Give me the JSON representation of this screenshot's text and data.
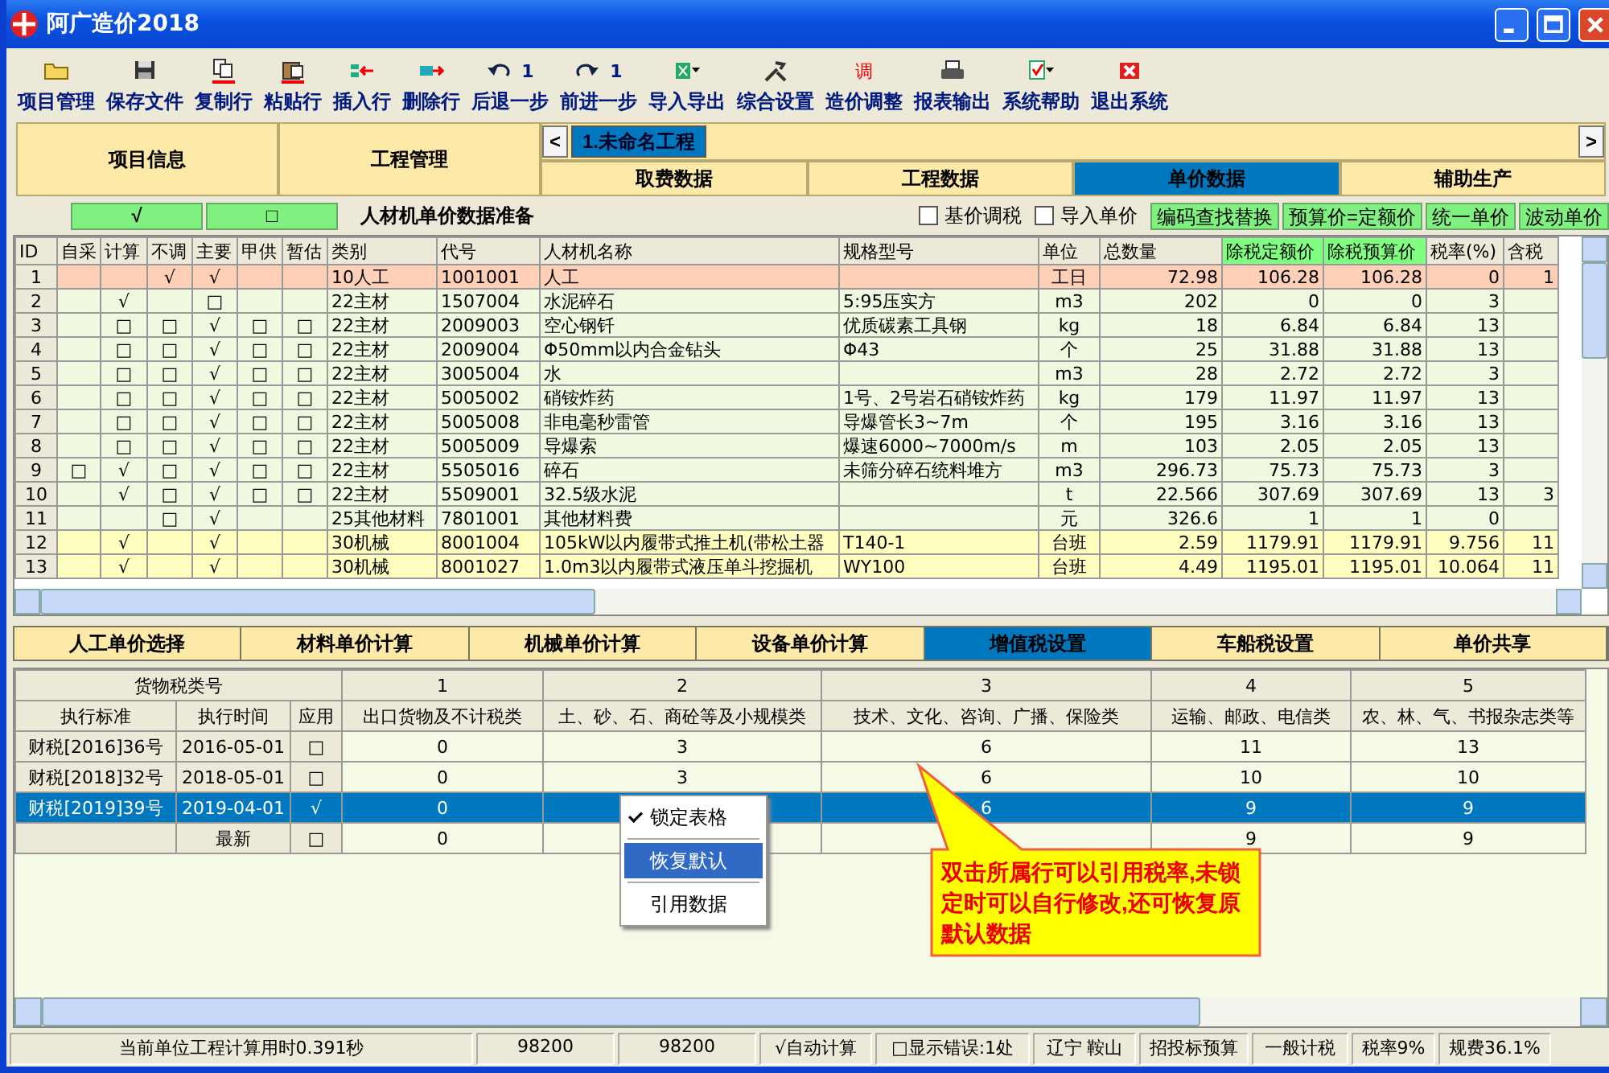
{
  "window": {
    "title": "阿广造价2018"
  },
  "toolbar": [
    {
      "label": "项目管理"
    },
    {
      "label": "保存文件"
    },
    {
      "label": "复制行"
    },
    {
      "label": "粘贴行"
    },
    {
      "label": "插入行"
    },
    {
      "label": "删除行"
    },
    {
      "label": "后退一步",
      "count": "1"
    },
    {
      "label": "前进一步",
      "count": "1"
    },
    {
      "label": "导入导出"
    },
    {
      "label": "综合设置"
    },
    {
      "label": "造价调整",
      "glyph": "调"
    },
    {
      "label": "报表输出"
    },
    {
      "label": "系统帮助"
    },
    {
      "label": "退出系统"
    }
  ],
  "nav": {
    "main_tabs": [
      "项目信息",
      "工程管理"
    ],
    "prev_arrow": "<",
    "next_arrow": ">",
    "project_tabs": [
      {
        "label": "1.未命名工程",
        "selected": true
      }
    ],
    "sub_tabs": [
      {
        "label": "取费数据",
        "selected": false
      },
      {
        "label": "工程数据",
        "selected": false
      },
      {
        "label": "单价数据",
        "selected": true
      },
      {
        "label": "辅助生产",
        "selected": false
      }
    ]
  },
  "actions": {
    "buttons": [
      "√",
      "□"
    ],
    "title": "人材机单价数据准备",
    "checkboxes": [
      {
        "label": "基价调税",
        "checked": false
      },
      {
        "label": "导入单价",
        "checked": false
      }
    ],
    "tool_buttons": [
      "编码查找替换",
      "预算价=定额价",
      "统一单价",
      "波动单价"
    ]
  },
  "grid": {
    "columns": [
      {
        "label": "ID",
        "highlight": false
      },
      {
        "label": "自采",
        "highlight": false
      },
      {
        "label": "计算",
        "highlight": false
      },
      {
        "label": "不调",
        "highlight": false
      },
      {
        "label": "主要",
        "highlight": false
      },
      {
        "label": "甲供",
        "highlight": false
      },
      {
        "label": "暂估",
        "highlight": false
      },
      {
        "label": "类别",
        "highlight": false
      },
      {
        "label": "代号",
        "highlight": false
      },
      {
        "label": "人材机名称",
        "highlight": false
      },
      {
        "label": "规格型号",
        "highlight": false
      },
      {
        "label": "单位",
        "highlight": false
      },
      {
        "label": "总数量",
        "highlight": false
      },
      {
        "label": "除税定额价",
        "highlight": true
      },
      {
        "label": "除税预算价",
        "highlight": true
      },
      {
        "label": "税率(%)",
        "highlight": false
      },
      {
        "label": "含税",
        "highlight": false
      }
    ],
    "rows": [
      {
        "kind": "labor",
        "cells": [
          "1",
          null,
          null,
          "√",
          "√",
          null,
          null,
          "10人工",
          "1001001",
          "人工",
          null,
          "工日",
          "72.98",
          "106.28",
          "106.28",
          "0",
          "1"
        ]
      },
      {
        "kind": "material",
        "cells": [
          "2",
          null,
          "√",
          null,
          "□",
          null,
          null,
          "22主材",
          "1507004",
          "水泥碎石",
          "5:95压实方",
          "m3",
          "202",
          "0",
          "0",
          "3",
          null
        ]
      },
      {
        "kind": "material",
        "cells": [
          "3",
          null,
          "□",
          "□",
          "√",
          "□",
          "□",
          "22主材",
          "2009003",
          "空心钢钎",
          "优质碳素工具钢",
          "kg",
          "18",
          "6.84",
          "6.84",
          "13",
          null
        ]
      },
      {
        "kind": "material",
        "cells": [
          "4",
          null,
          "□",
          "□",
          "√",
          "□",
          "□",
          "22主材",
          "2009004",
          "Φ50mm以内合金钻头",
          "Φ43",
          "个",
          "25",
          "31.88",
          "31.88",
          "13",
          null
        ]
      },
      {
        "kind": "material",
        "cells": [
          "5",
          null,
          "□",
          "□",
          "√",
          "□",
          "□",
          "22主材",
          "3005004",
          "水",
          null,
          "m3",
          "28",
          "2.72",
          "2.72",
          "3",
          null
        ]
      },
      {
        "kind": "material",
        "cells": [
          "6",
          null,
          "□",
          "□",
          "√",
          "□",
          "□",
          "22主材",
          "5005002",
          "硝铵炸药",
          "1号、2号岩石硝铵炸药",
          "kg",
          "179",
          "11.97",
          "11.97",
          "13",
          null
        ]
      },
      {
        "kind": "material",
        "cells": [
          "7",
          null,
          "□",
          "□",
          "√",
          "□",
          "□",
          "22主材",
          "5005008",
          "非电毫秒雷管",
          "导爆管长3~7m",
          "个",
          "195",
          "3.16",
          "3.16",
          "13",
          null
        ]
      },
      {
        "kind": "material",
        "cells": [
          "8",
          null,
          "□",
          "□",
          "√",
          "□",
          "□",
          "22主材",
          "5005009",
          "导爆索",
          "爆速6000~7000m/s",
          "m",
          "103",
          "2.05",
          "2.05",
          "13",
          null
        ]
      },
      {
        "kind": "material",
        "cells": [
          "9",
          "□",
          "√",
          "□",
          "√",
          "□",
          "□",
          "22主材",
          "5505016",
          "碎石",
          "未筛分碎石统料堆方",
          "m3",
          "296.73",
          "75.73",
          "75.73",
          "3",
          null
        ]
      },
      {
        "kind": "material",
        "cells": [
          "10",
          null,
          "√",
          "□",
          "√",
          "□",
          "□",
          "22主材",
          "5509001",
          "32.5级水泥",
          null,
          "t",
          "22.566",
          "307.69",
          "307.69",
          "13",
          "3"
        ]
      },
      {
        "kind": "material",
        "cells": [
          "11",
          null,
          null,
          "□",
          "√",
          null,
          null,
          "25其他材料",
          "7801001",
          "其他材料费",
          null,
          "元",
          "326.6",
          "1",
          "1",
          "0",
          null
        ]
      },
      {
        "kind": "machine",
        "cells": [
          "12",
          null,
          "√",
          null,
          "√",
          null,
          null,
          "30机械",
          "8001004",
          "105kW以内履带式推土机(带松土器",
          "T140-1",
          "台班",
          "2.59",
          "1179.91",
          "1179.91",
          "9.756",
          "11"
        ]
      },
      {
        "kind": "machine",
        "cells": [
          "13",
          null,
          "√",
          null,
          "√",
          null,
          null,
          "30机械",
          "8001027",
          "1.0m3以内履带式液压单斗挖掘机",
          "WY100",
          "台班",
          "4.49",
          "1195.01",
          "1195.01",
          "10.064",
          "11"
        ]
      }
    ]
  },
  "price_tabs": [
    {
      "label": "人工单价选择",
      "selected": false
    },
    {
      "label": "材料单价计算",
      "selected": false
    },
    {
      "label": "机械单价计算",
      "selected": false
    },
    {
      "label": "设备单价计算",
      "selected": false
    },
    {
      "label": "增值税设置",
      "selected": true
    },
    {
      "label": "车船税设置",
      "selected": false
    },
    {
      "label": "单价共享",
      "selected": false
    }
  ],
  "tax_table": {
    "group_header": "货物税类号",
    "class_numbers": [
      "1",
      "2",
      "3",
      "4",
      "5"
    ],
    "columns": [
      "执行标准",
      "执行时间",
      "应用",
      "出口货物及不计税类",
      "土、砂、石、商砼等及小规模类",
      "技术、文化、咨询、广播、保险类",
      "运输、邮政、电信类",
      "农、林、气、书报杂志类等"
    ],
    "rows": [
      {
        "selected": false,
        "cells": [
          "财税[2016]36号",
          "2016-05-01",
          "□",
          "0",
          "3",
          "6",
          "11",
          "13"
        ]
      },
      {
        "selected": false,
        "cells": [
          "财税[2018]32号",
          "2018-05-01",
          "□",
          "0",
          "3",
          "6",
          "10",
          "10"
        ]
      },
      {
        "selected": true,
        "cells": [
          "财税[2019]39号",
          "2019-04-01",
          "√",
          "0",
          null,
          "6",
          "9",
          "9"
        ]
      },
      {
        "selected": false,
        "cells": [
          null,
          "最新",
          "□",
          "0",
          null,
          null,
          "9",
          "9"
        ]
      }
    ]
  },
  "context_menu": {
    "items": [
      {
        "label": "锁定表格",
        "checked": true,
        "selected": false
      },
      {
        "label": "恢复默认",
        "checked": false,
        "selected": true
      },
      {
        "label": "引用数据",
        "checked": false,
        "selected": false
      }
    ]
  },
  "callout": {
    "text": "双击所属行可以引用税率,未锁定时可以自行修改,还可恢复原默认数据"
  },
  "status_bar": [
    "当前单位工程计算用时0.391秒",
    "98200",
    "98200",
    "√自动计算",
    "□显示错误:1处",
    "辽宁 鞍山",
    "招投标预算",
    "一般计税",
    "税率9%",
    "规费36.1%"
  ]
}
